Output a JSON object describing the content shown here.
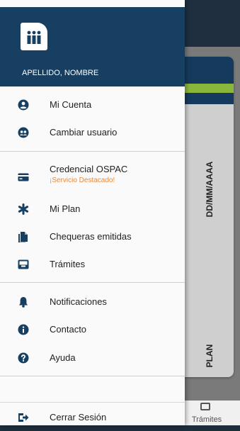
{
  "user": {
    "name": "APELLIDO, NOMBRE"
  },
  "menu": {
    "mi_cuenta": "Mi Cuenta",
    "cambiar_usuario": "Cambiar usuario",
    "credencial": "Credencial OSPAC",
    "credencial_sub": "¡Servicio Destacado!",
    "mi_plan": "Mi Plan",
    "chequeras": "Chequeras emitidas",
    "tramites": "Trámites",
    "notificaciones": "Notificaciones",
    "contacto": "Contacto",
    "ayuda": "Ayuda",
    "cerrar_sesion": "Cerrar Sesión"
  },
  "background": {
    "card_date": "DD/MM/AAAA",
    "card_plan": "PLAN",
    "tab_tramites": "Trámites"
  },
  "colors": {
    "header": "#173f61",
    "accent_green": "#8bb63c",
    "icon": "#173f61",
    "subtitle": "#e8893a"
  }
}
